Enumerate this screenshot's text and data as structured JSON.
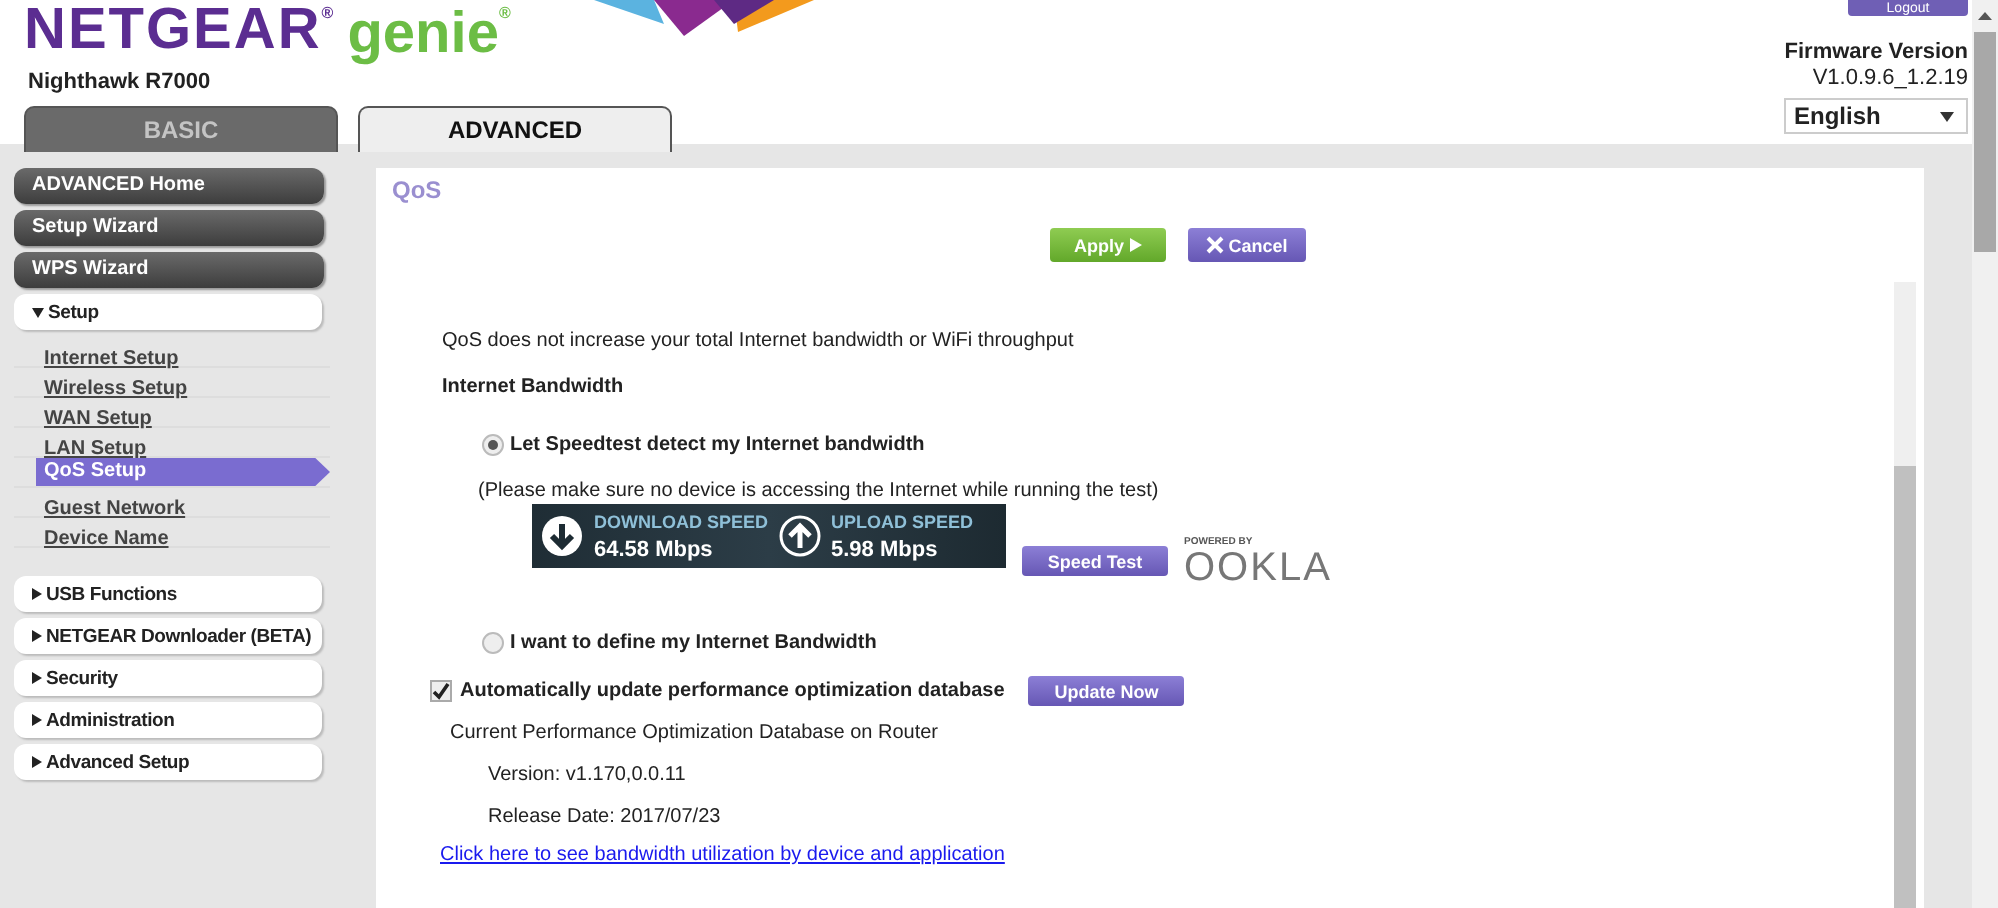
{
  "header": {
    "logo": {
      "brand": "NETGEAR",
      "brand_mark": "®",
      "product": "genie",
      "product_mark": "®"
    },
    "model": "Nighthawk R7000",
    "tabs": [
      {
        "label": "BASIC",
        "selected": false
      },
      {
        "label": "ADVANCED",
        "selected": true
      }
    ],
    "logout": "Logout",
    "firmware": {
      "label": "Firmware Version",
      "version": "V1.0.9.6_1.2.19"
    },
    "language": "English"
  },
  "sidebar": {
    "items": [
      {
        "kind": "button",
        "label": "ADVANCED Home"
      },
      {
        "kind": "button",
        "label": "Setup Wizard"
      },
      {
        "kind": "button",
        "label": "WPS Wizard"
      },
      {
        "kind": "section",
        "label": "Setup",
        "expanded": true,
        "children": [
          {
            "label": "Internet Setup",
            "selected": false
          },
          {
            "label": "Wireless Setup",
            "selected": false
          },
          {
            "label": "WAN Setup",
            "selected": false
          },
          {
            "label": "LAN Setup",
            "selected": false
          },
          {
            "label": "QoS Setup",
            "selected": true
          },
          {
            "label": "Guest Network",
            "selected": false
          },
          {
            "label": "Device Name",
            "selected": false
          }
        ]
      },
      {
        "kind": "section",
        "label": "USB Functions",
        "expanded": false
      },
      {
        "kind": "section",
        "label": "NETGEAR Downloader (BETA)",
        "expanded": false
      },
      {
        "kind": "section",
        "label": "Security",
        "expanded": false
      },
      {
        "kind": "section",
        "label": "Administration",
        "expanded": false
      },
      {
        "kind": "section",
        "label": "Advanced Setup",
        "expanded": false
      }
    ]
  },
  "content": {
    "title": "QoS",
    "apply": "Apply",
    "cancel": "Cancel",
    "note": "QoS does not increase your total Internet bandwidth or WiFi throughput",
    "section_heading": "Internet Bandwidth",
    "options": [
      {
        "label": "Let Speedtest detect my Internet bandwidth",
        "selected": true
      },
      {
        "label": "I want to define my Internet Bandwidth",
        "selected": false
      }
    ],
    "speedtest_hint": "(Please make sure no device is accessing the Internet while running the test)",
    "download": {
      "label": "DOWNLOAD SPEED",
      "value": "64.58 Mbps"
    },
    "upload": {
      "label": "UPLOAD SPEED",
      "value": "5.98 Mbps"
    },
    "speed_test_button": "Speed Test",
    "powered_by": "POWERED BY",
    "ookla": "OOKLA",
    "auto_update": {
      "label": "Automatically update performance optimization database",
      "checked": true
    },
    "update_now": "Update Now",
    "db_heading": "Current Performance Optimization Database on Router",
    "db_version": "Version: v1.170,0.0.11",
    "db_date": "Release Date: 2017/07/23",
    "link": "Click here to see bandwidth utilization by device and application"
  }
}
